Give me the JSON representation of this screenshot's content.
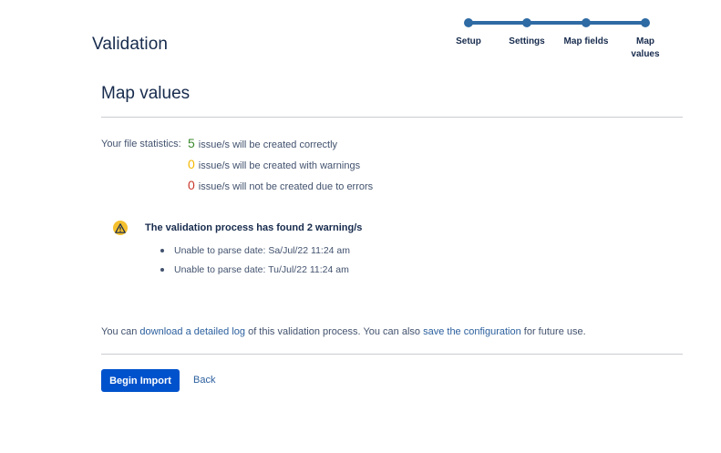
{
  "header": {
    "title": "Validation"
  },
  "tracker": {
    "steps": [
      {
        "label": "Setup"
      },
      {
        "label": "Settings"
      },
      {
        "label": "Map fields"
      },
      {
        "label": "Map values"
      }
    ],
    "color": "#2e6aa3"
  },
  "section": {
    "title": "Map values"
  },
  "stats": {
    "label": "Your file statistics:",
    "rows": [
      {
        "count": "5",
        "text": "issue/s will be created correctly",
        "color": "#3c8a2e"
      },
      {
        "count": "0",
        "text": "issue/s will be created with warnings",
        "color": "#f5b800"
      },
      {
        "count": "0",
        "text": "issue/s will not be created due to errors",
        "color": "#c9372c"
      }
    ]
  },
  "warnings": {
    "icon": "warning-icon",
    "title": "The validation process has found 2 warning/s",
    "items": [
      "Unable to parse date: Sa/Jul/22 11:24 am",
      "Unable to parse date: Tu/Jul/22 11:24 am"
    ]
  },
  "log": {
    "prefix": "You can ",
    "log_link": "download a detailed log",
    "middle": " of this validation process. You can also ",
    "config_link": "save the configuration",
    "suffix": " for future use."
  },
  "actions": {
    "begin_import": "Begin Import",
    "back": "Back"
  },
  "colors": {
    "primary": "#0052cc",
    "link": "#2b5f9e"
  }
}
